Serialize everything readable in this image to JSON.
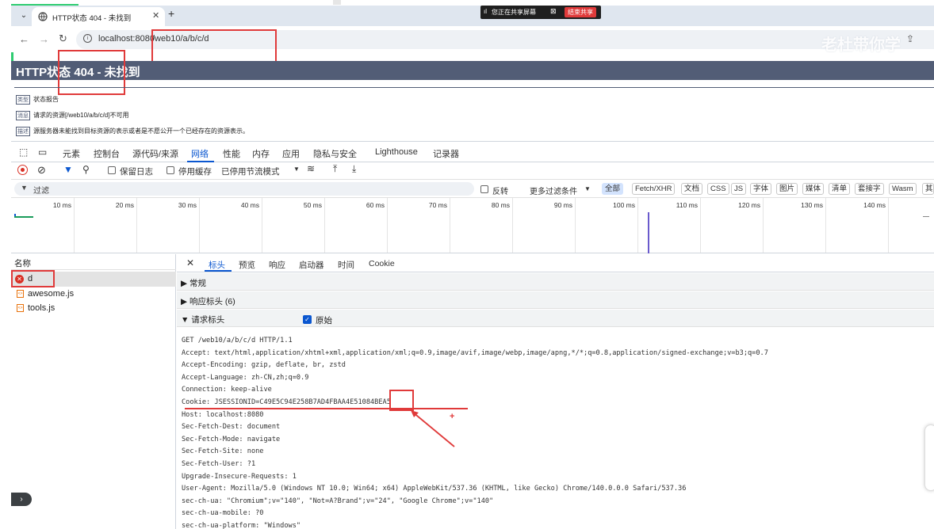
{
  "browser": {
    "tab_title": "HTTP状态 404 - 未找到",
    "url_host": "localhost:8080",
    "url_path": "/web10/a/b/c/d"
  },
  "share_bar": {
    "sharing_text": "您正在共享屏幕",
    "stop_label": "结束共享"
  },
  "watermark": "老杜带你学",
  "page": {
    "heading": "HTTP状态 404 - 未找到",
    "rows": [
      {
        "tag": "类型",
        "text": "状态报告"
      },
      {
        "tag": "消息",
        "text": "请求的资源[/web10/a/b/c/d]不可用"
      },
      {
        "tag": "描述",
        "text": "源服务器未能找到目标资源的表示或者是不愿公开一个已经存在的资源表示。"
      }
    ]
  },
  "devtools": {
    "tabs": [
      "元素",
      "控制台",
      "源代码/来源",
      "网络",
      "性能",
      "内存",
      "应用",
      "隐私与安全",
      "Lighthouse",
      "记录器"
    ],
    "active_tab": "网络",
    "toolbar": {
      "preserve_log": "保留日志",
      "disable_cache": "停用缓存",
      "throttle": "已停用节流模式"
    },
    "filter": {
      "placeholder": "过滤",
      "invert": "反转",
      "more_filters": "更多过滤条件",
      "chips": [
        "全部",
        "Fetch/XHR",
        "文档",
        "CSS",
        "JS",
        "字体",
        "图片",
        "媒体",
        "清单",
        "套接字",
        "Wasm",
        "其"
      ]
    },
    "timeline_ticks": [
      "10 ms",
      "20 ms",
      "30 ms",
      "40 ms",
      "50 ms",
      "60 ms",
      "70 ms",
      "80 ms",
      "90 ms",
      "100 ms",
      "110 ms",
      "120 ms",
      "130 ms",
      "140 ms",
      "15"
    ],
    "name_header": "名称",
    "requests": [
      {
        "name": "d",
        "status": "error"
      },
      {
        "name": "awesome.js",
        "status": "ok"
      },
      {
        "name": "tools.js",
        "status": "ok"
      }
    ],
    "detail_tabs": [
      "标头",
      "预览",
      "响应",
      "启动器",
      "时间",
      "Cookie"
    ],
    "active_detail_tab": "标头",
    "sections": {
      "general": "▶ 常规",
      "response_headers": "▶ 响应标头 (6)",
      "request_headers": "▼ 请求标头",
      "raw_label": "原始"
    },
    "raw_headers": [
      "GET /web10/a/b/c/d HTTP/1.1",
      "Accept: text/html,application/xhtml+xml,application/xml;q=0.9,image/avif,image/webp,image/apng,*/*;q=0.8,application/signed-exchange;v=b3;q=0.7",
      "Accept-Encoding: gzip, deflate, br, zstd",
      "Accept-Language: zh-CN,zh;q=0.9",
      "Connection: keep-alive",
      "Cookie: JSESSIONID=C49E5C94E258B7AD4FBAA4E51084BEA5",
      "Host: localhost:8080",
      "Sec-Fetch-Dest: document",
      "Sec-Fetch-Mode: navigate",
      "Sec-Fetch-Site: none",
      "Sec-Fetch-User: ?1",
      "Upgrade-Insecure-Requests: 1",
      "User-Agent: Mozilla/5.0 (Windows NT 10.0; Win64; x64) AppleWebKit/537.36 (KHTML, like Gecko) Chrome/140.0.0.0 Safari/537.36",
      "sec-ch-ua: \"Chromium\";v=\"140\", \"Not=A?Brand\";v=\"24\", \"Google Chrome\";v=\"140\"",
      "sec-ch-ua-mobile: ?0",
      "sec-ch-ua-platform: \"Windows\""
    ]
  },
  "colors": {
    "annotation": "#e03a3a",
    "active": "#0b57d0",
    "tomcat": "#525d76"
  }
}
